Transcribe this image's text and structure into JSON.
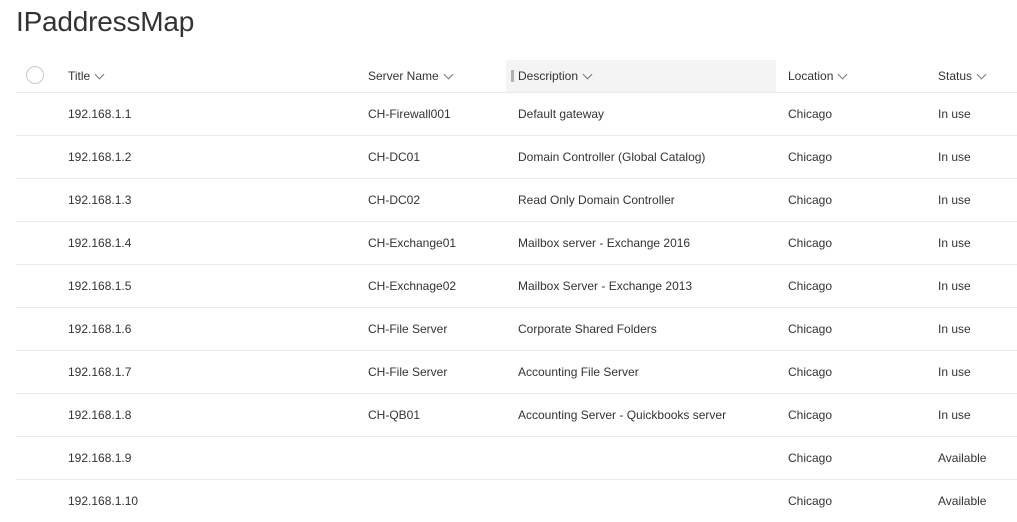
{
  "page": {
    "title": "IPaddressMap"
  },
  "columns": {
    "title": "Title",
    "server_name": "Server Name",
    "description": "Description",
    "location": "Location",
    "status": "Status"
  },
  "rows": [
    {
      "title": "192.168.1.1",
      "server_name": "CH-Firewall001",
      "description": "Default gateway",
      "location": "Chicago",
      "status": "In use"
    },
    {
      "title": "192.168.1.2",
      "server_name": "CH-DC01",
      "description": "Domain Controller (Global Catalog)",
      "location": "Chicago",
      "status": "In use"
    },
    {
      "title": "192.168.1.3",
      "server_name": "CH-DC02",
      "description": "Read Only Domain Controller",
      "location": "Chicago",
      "status": "In use"
    },
    {
      "title": "192.168.1.4",
      "server_name": "CH-Exchange01",
      "description": "Mailbox server - Exchange 2016",
      "location": "Chicago",
      "status": "In use"
    },
    {
      "title": "192.168.1.5",
      "server_name": "CH-Exchnage02",
      "description": "Mailbox Server - Exchange 2013",
      "location": "Chicago",
      "status": "In use"
    },
    {
      "title": "192.168.1.6",
      "server_name": "CH-File Server",
      "description": "Corporate Shared Folders",
      "location": "Chicago",
      "status": "In use"
    },
    {
      "title": "192.168.1.7",
      "server_name": "CH-File Server",
      "description": "Accounting File Server",
      "location": "Chicago",
      "status": "In use"
    },
    {
      "title": "192.168.1.8",
      "server_name": "CH-QB01",
      "description": "Accounting Server - Quickbooks server",
      "location": "Chicago",
      "status": "In use"
    },
    {
      "title": "192.168.1.9",
      "server_name": "",
      "description": "",
      "location": "Chicago",
      "status": "Available"
    },
    {
      "title": "192.168.1.10",
      "server_name": "",
      "description": "",
      "location": "Chicago",
      "status": "Available"
    }
  ]
}
